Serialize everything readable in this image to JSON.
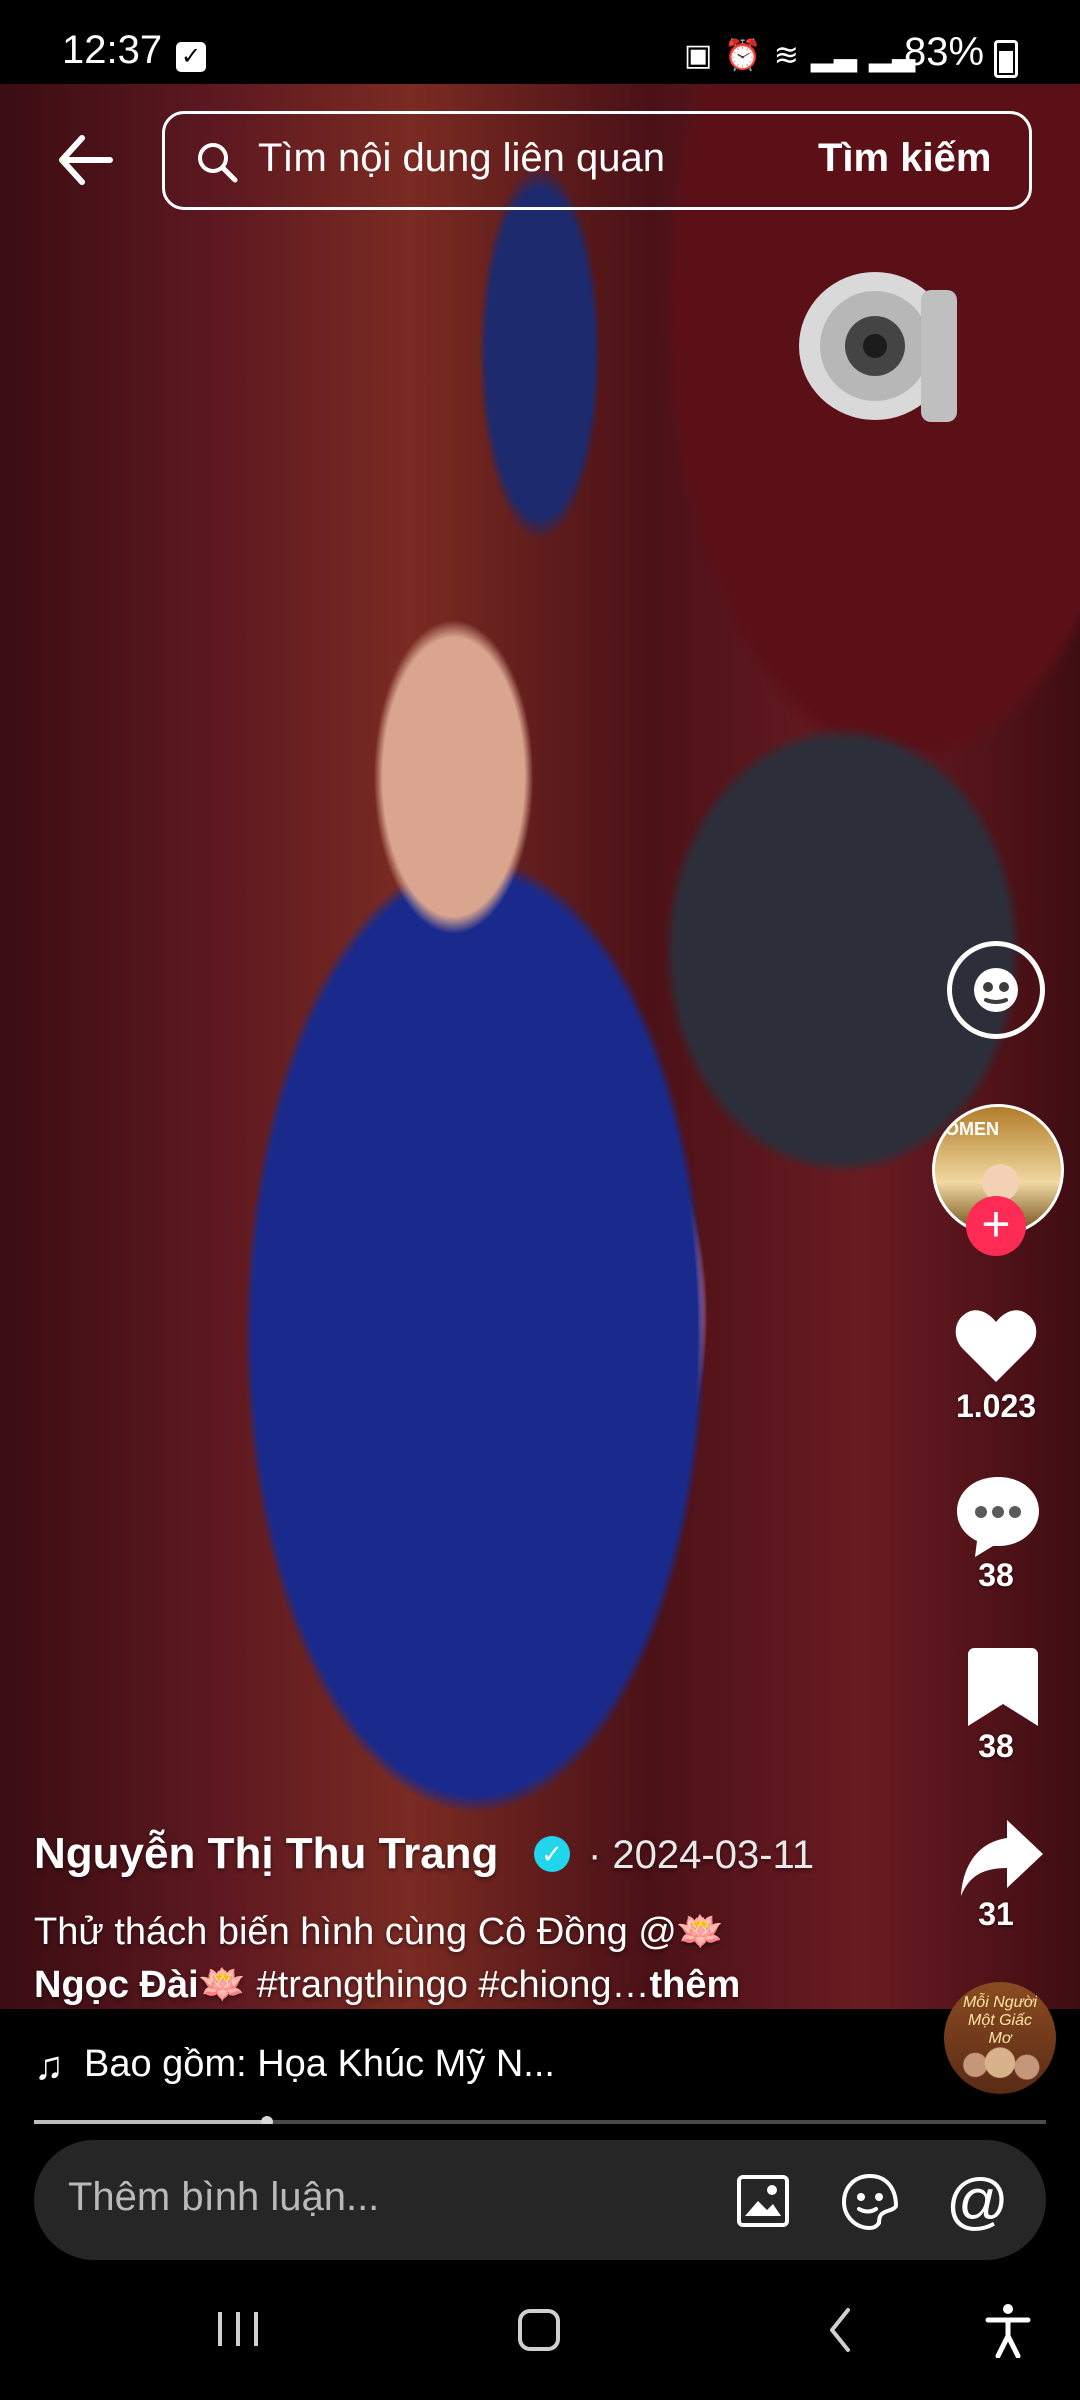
{
  "status_bar": {
    "time": "12:37",
    "battery": "83%"
  },
  "search": {
    "placeholder": "Tìm nội dung liên quan",
    "button": "Tìm kiếm"
  },
  "right_rail": {
    "likes": "1.023",
    "comments": "38",
    "saves": "38",
    "shares": "31",
    "avatar_text": "OMEN"
  },
  "caption": {
    "author": "Nguyễn Thị Thu Trang",
    "date": "· 2024-03-11",
    "line1": "Thử thách biến hình cùng Cô Đồng @🪷",
    "line2_name": "Ngọc Đài🪷",
    "line2_tags": " #trangthingo #chiong…",
    "more": "thêm"
  },
  "music": {
    "text": "Bao gồm: Họa Khúc Mỹ N...",
    "disc_text": "Mỗi Người Một Giấc Mơ"
  },
  "video": {
    "progress": 0.23
  },
  "comment": {
    "placeholder": "Thêm bình luận..."
  },
  "colors": {
    "accent": "#fe2c55",
    "verified": "#20d5ec"
  }
}
